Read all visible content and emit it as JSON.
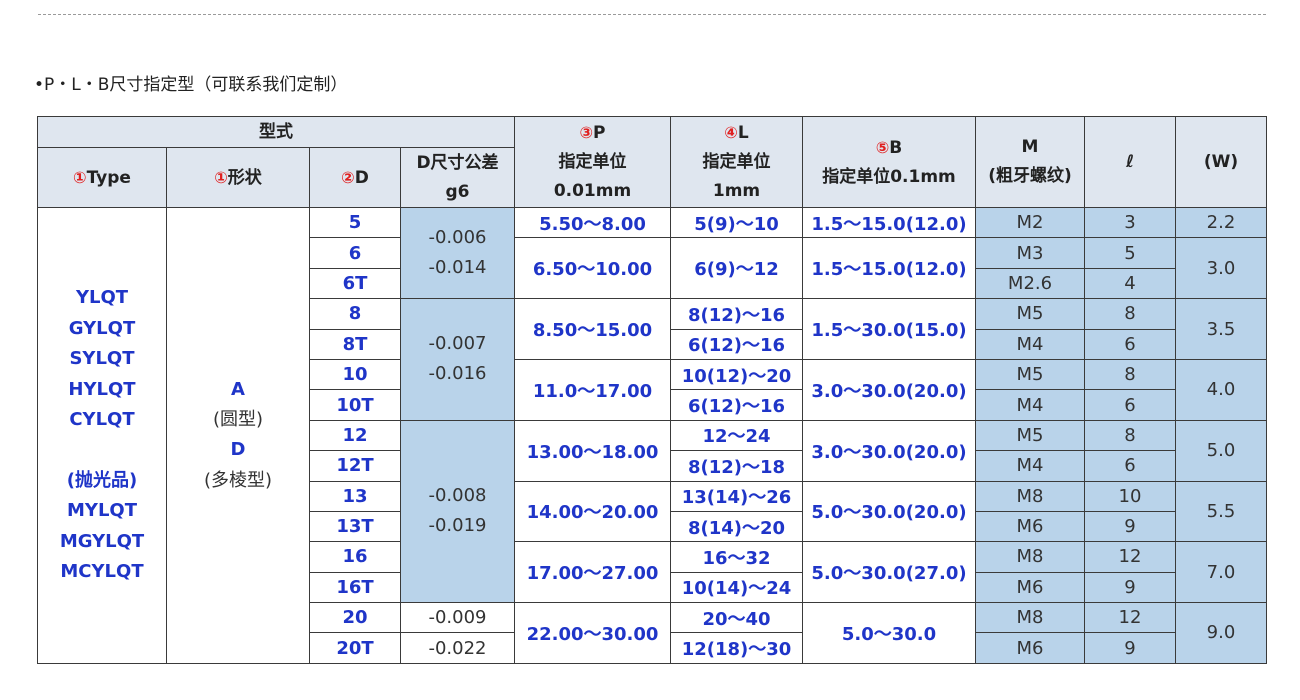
{
  "section_title": "•P・L・B尺寸指定型（可联系我们定制）",
  "header": {
    "group": "型式",
    "type_circ": "①",
    "type": "Type",
    "shape_circ": "①",
    "shape": "形状",
    "d_circ": "②",
    "d": "D",
    "dtol_line1": "D尺寸公差",
    "dtol_line2": "g6",
    "p_circ": "③",
    "p": "P",
    "p_line2": "指定单位",
    "p_line3": "0.01mm",
    "l_circ": "④",
    "l": "L",
    "l_line2": "指定单位",
    "l_line3": "1mm",
    "b_circ": "⑤",
    "b": "B",
    "b_line2": "指定单位0.1mm",
    "m_line1": "M",
    "m_line2": "(粗牙螺纹)",
    "ell": "ℓ",
    "w": "(W)"
  },
  "types": [
    "YLQT",
    "GYLQT",
    "SYLQT",
    "HYLQT",
    "CYLQT",
    "",
    "(抛光品)",
    "MYLQT",
    "MGYLQT",
    "MCYLQT"
  ],
  "shape": {
    "a": "A",
    "a_desc": "(圆型)",
    "d": "D",
    "d_desc": "(多棱型)"
  },
  "d_values": [
    "5",
    "6",
    "6T",
    "8",
    "8T",
    "10",
    "10T",
    "12",
    "12T",
    "13",
    "13T",
    "16",
    "16T",
    "20",
    "20T"
  ],
  "tolerances": [
    {
      "upper": "-0.006",
      "lower": "-0.014"
    },
    {
      "upper": "-0.007",
      "lower": "-0.016"
    },
    {
      "upper": "-0.008",
      "lower": "-0.019"
    },
    {
      "upper": "-0.009",
      "lower": "-0.022"
    }
  ],
  "p_values": [
    "5.50～8.00",
    "6.50～10.00",
    "8.50～15.00",
    "11.0～17.00",
    "13.00～18.00",
    "14.00～20.00",
    "17.00～27.00",
    "22.00～30.00"
  ],
  "l_values": [
    "5(9)～10",
    "6(9)～12",
    "8(12)～16",
    "6(12)～16",
    "10(12)～20",
    "6(12)～16",
    "12～24",
    "8(12)～18",
    "13(14)～26",
    "8(14)～20",
    "16～32",
    "10(14)～24",
    "20～40",
    "12(18)～30"
  ],
  "b_values": [
    "1.5～15.0(12.0)",
    "1.5～15.0(12.0)",
    "1.5～30.0(15.0)",
    "3.0～30.0(20.0)",
    "3.0～30.0(20.0)",
    "5.0～30.0(20.0)",
    "5.0～30.0(27.0)",
    "5.0～30.0"
  ],
  "m_values": [
    "M2",
    "M3",
    "M2.6",
    "M5",
    "M4",
    "M5",
    "M4",
    "M5",
    "M4",
    "M8",
    "M6",
    "M8",
    "M6",
    "M8",
    "M6"
  ],
  "ell_values": [
    "3",
    "5",
    "4",
    "8",
    "6",
    "8",
    "6",
    "8",
    "6",
    "10",
    "9",
    "12",
    "9",
    "12",
    "9"
  ],
  "w_values": [
    "2.2",
    "3.0",
    "3.5",
    "4.0",
    "5.0",
    "5.5",
    "7.0",
    "9.0"
  ],
  "colors": {
    "accent_blue": "#1f35c8",
    "marker_red": "#e02020",
    "shade_blue": "#b9d3ea",
    "header_gray": "#dfe6ef"
  }
}
